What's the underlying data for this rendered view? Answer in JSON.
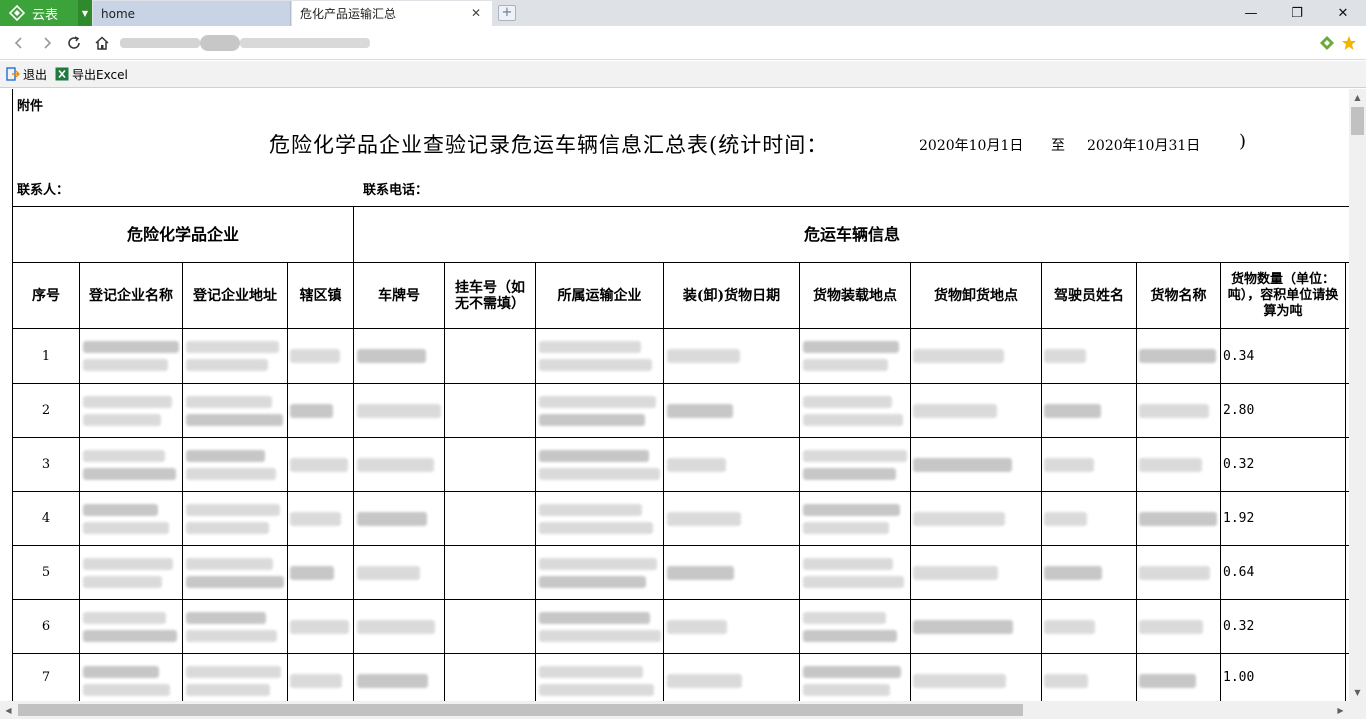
{
  "browser": {
    "app_name": "云表",
    "tabs": [
      {
        "label": "home"
      },
      {
        "label": "危化产品运输汇总"
      }
    ],
    "new_tab_symbol": "+",
    "window_controls": {
      "minimize": "—",
      "maximize": "❐",
      "close": "✕"
    },
    "close_tab_symbol": "✕"
  },
  "toolbar": {
    "exit_label": "退出",
    "export_label": "导出Excel"
  },
  "report": {
    "attachment_label": "附件",
    "title": "危险化学品企业查验记录危运车辆信息汇总表(统计时间：",
    "period_start": "2020年10月1日",
    "period_to": "至",
    "period_end": "2020年10月31日",
    "period_close": ")",
    "contact_label": "联系人：",
    "phone_label": "联系电话：",
    "group_headers": {
      "enterprise": "危险化学品企业",
      "vehicle": "危运车辆信息"
    },
    "columns": [
      "序号",
      "登记企业名称",
      "登记企业地址",
      "辖区镇",
      "车牌号",
      "挂车号（如无不需填）",
      "所属运输企业",
      "装(卸)货物日期",
      "货物装载地点",
      "货物卸货地点",
      "驾驶员姓名",
      "货物名称",
      "货物数量（单位：吨），容积单位请换算为吨"
    ],
    "rows": [
      {
        "no": "1",
        "quantity": "0.34"
      },
      {
        "no": "2",
        "quantity": "2.80"
      },
      {
        "no": "3",
        "quantity": "0.32"
      },
      {
        "no": "4",
        "quantity": "1.92"
      },
      {
        "no": "5",
        "quantity": "0.64"
      },
      {
        "no": "6",
        "quantity": "0.32"
      },
      {
        "no": "7",
        "quantity": "1.00"
      }
    ]
  },
  "colors": {
    "app_green": "#3ca23a",
    "tab_bar": "#dee1e6",
    "inactive_tab": "#c8d4e6",
    "toolbar_bg": "#f2f2f2"
  }
}
